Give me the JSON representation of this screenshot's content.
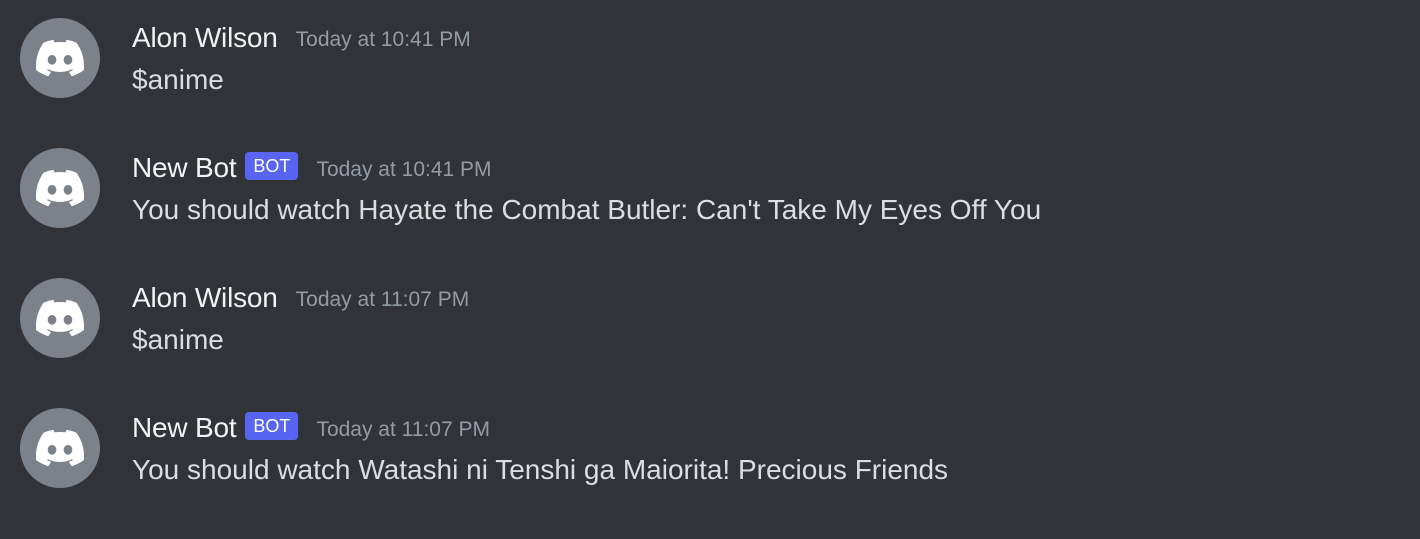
{
  "messages": [
    {
      "author": "Alon Wilson",
      "is_bot": false,
      "timestamp": "Today at 10:41 PM",
      "content": "$anime"
    },
    {
      "author": "New Bot",
      "is_bot": true,
      "bot_tag": "BOT",
      "timestamp": "Today at 10:41 PM",
      "content": "You should watch Hayate the Combat Butler: Can't Take My Eyes Off You"
    },
    {
      "author": "Alon Wilson",
      "is_bot": false,
      "timestamp": "Today at 11:07 PM",
      "content": "$anime"
    },
    {
      "author": "New Bot",
      "is_bot": true,
      "bot_tag": "BOT",
      "timestamp": "Today at 11:07 PM",
      "content": "You should watch Watashi ni Tenshi ga Maiorita! Precious Friends"
    }
  ],
  "avatar_icon": "discord-logo-icon",
  "colors": {
    "background": "#313338",
    "avatar_bg": "#7d8189",
    "username": "#f2f3f5",
    "timestamp": "#949ba4",
    "message_text": "#dbdee1",
    "bot_tag_bg": "#5865f2"
  }
}
